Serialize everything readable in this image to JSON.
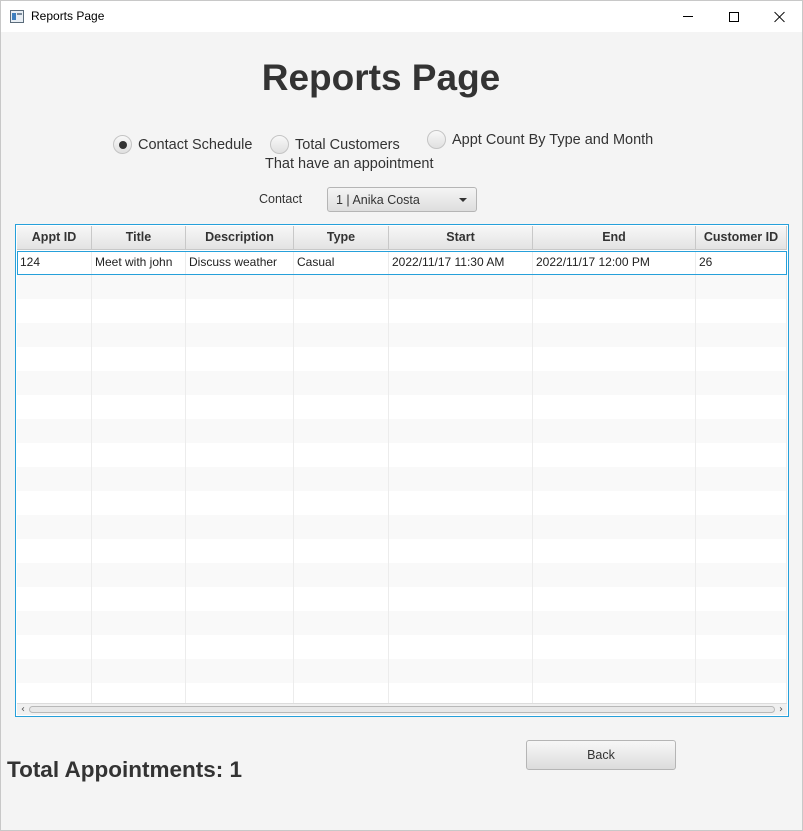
{
  "window": {
    "title": "Reports Page",
    "icon": "app-window-icon",
    "controls": [
      "minimize-icon",
      "maximize-icon",
      "close-icon"
    ]
  },
  "header": {
    "title": "Reports Page"
  },
  "report_options": {
    "contact_schedule": {
      "label": "Contact Schedule",
      "selected": true
    },
    "total_customers": {
      "label": "Total Customers",
      "sublabel": "That have an appointment",
      "selected": false
    },
    "appt_count": {
      "label": "Appt Count By Type and Month",
      "selected": false
    }
  },
  "contact": {
    "label": "Contact",
    "selected_value": "1 | Anika Costa"
  },
  "table": {
    "columns": [
      "Appt ID",
      "Title",
      "Description",
      "Type",
      "Start",
      "End",
      "Customer ID"
    ],
    "rows": [
      [
        "124",
        "Meet with john",
        "Discuss weather",
        "Casual",
        "2022/11/17 11:30 AM",
        "2022/11/17 12:00 PM",
        "26"
      ]
    ],
    "empty_row_count": 18
  },
  "footer": {
    "back_label": "Back",
    "total_label": "Total Appointments: 1"
  },
  "colors": {
    "selection_border": "#26a0da",
    "background": "#f4f4f4",
    "text": "#333333"
  }
}
